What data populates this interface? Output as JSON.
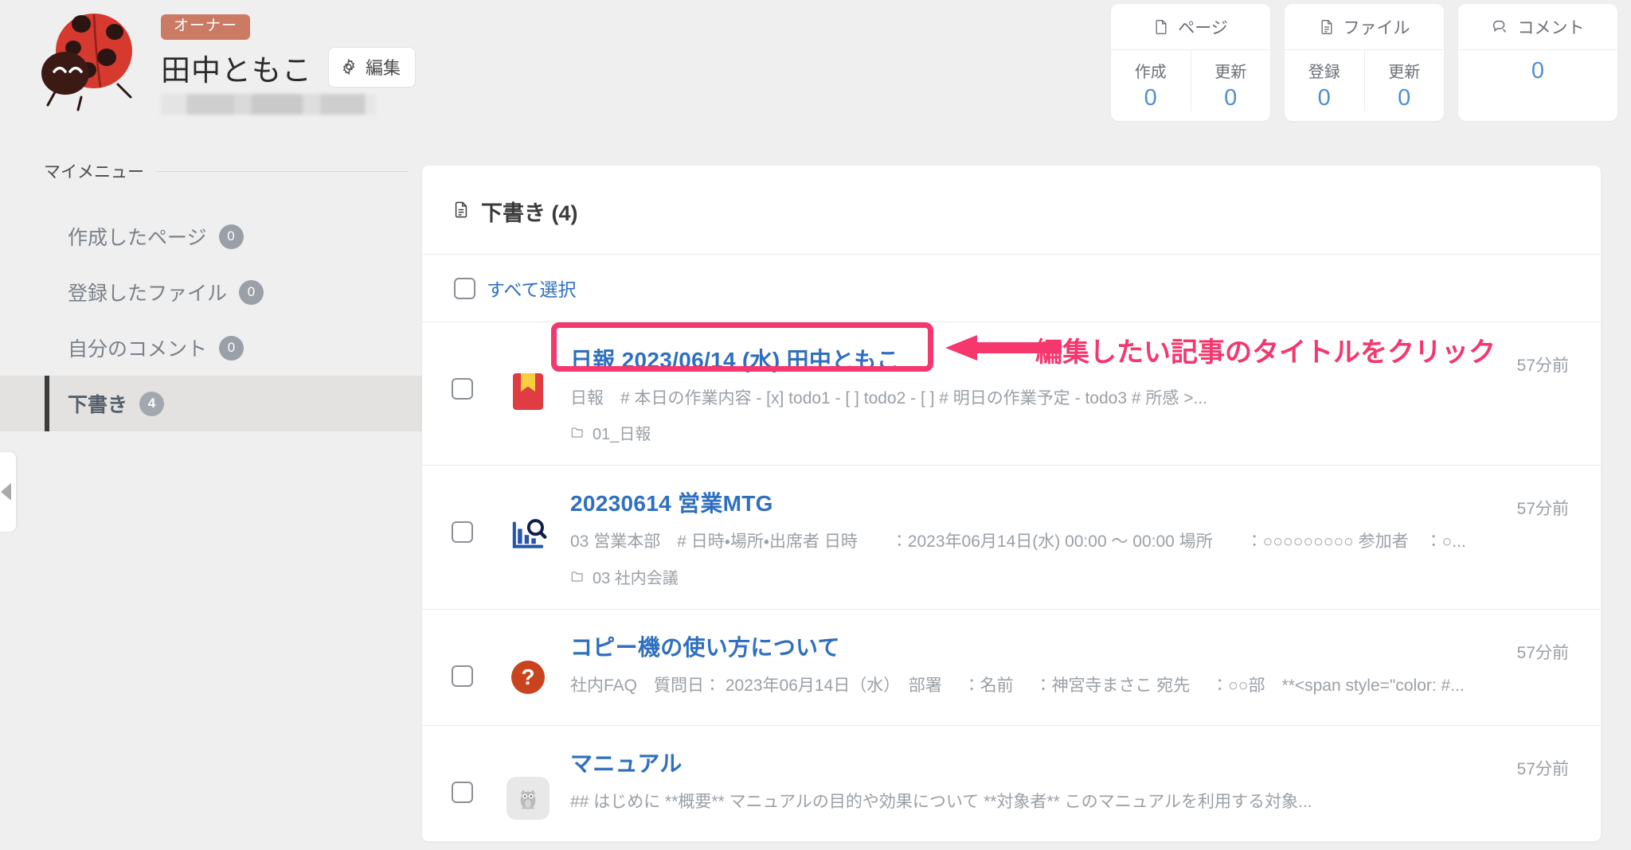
{
  "profile": {
    "badge": "オーナー",
    "name": "田中ともこ",
    "edit_label": "編集",
    "avatar_icon": "ladybug-avatar",
    "email_masked": ""
  },
  "stats": [
    {
      "icon": "page-icon",
      "title": "ページ",
      "columns": [
        {
          "label": "作成",
          "value": "0"
        },
        {
          "label": "更新",
          "value": "0"
        }
      ]
    },
    {
      "icon": "file-icon",
      "title": "ファイル",
      "columns": [
        {
          "label": "登録",
          "value": "0"
        },
        {
          "label": "更新",
          "value": "0"
        }
      ]
    },
    {
      "icon": "comment-icon",
      "title": "コメント",
      "columns": [
        {
          "label": "",
          "value": "0"
        }
      ]
    }
  ],
  "sidebar": {
    "section_title": "マイメニュー",
    "collapse_icon": "chevron-left-icon",
    "items": [
      {
        "label": "作成したページ",
        "count": "0",
        "active": false
      },
      {
        "label": "登録したファイル",
        "count": "0",
        "active": false
      },
      {
        "label": "自分のコメント",
        "count": "0",
        "active": false
      },
      {
        "label": "下書き",
        "count": "4",
        "active": true
      }
    ]
  },
  "panel": {
    "icon": "draft-document-icon",
    "title": "下書き (4)",
    "select_all_label": "すべて選択",
    "rows": [
      {
        "icon": "red-book-icon",
        "title": "日報 2023/06/14 (水) 田中ともこ",
        "desc": "日報　# 本日の作業内容 - [x] todo1 - [ ] todo2 - [ ] # 明日の作業予定 - todo3 # 所感 >...",
        "folder": "01_日報",
        "time": "57分前",
        "highlighted": true
      },
      {
        "icon": "chart-search-icon",
        "title": "20230614 営業MTG",
        "desc": "03 営業本部　# 日時・場所・出席者 日時　　：2023年06月14日(水) 00:00 〜 00:00 場所　　：○○○○○○○○○ 参加者　：○...",
        "folder": "03 社内会議",
        "time": "57分前",
        "highlighted": false
      },
      {
        "icon": "question-mark-icon",
        "title": "コピー機の使い方について",
        "desc": "社内FAQ　質問日： 2023年06月14日（水）　部署　 ：名前　 ：神宮寺まさこ 宛先　 ：○○部　**<span style=\"color: #...",
        "folder": "",
        "time": "57分前",
        "highlighted": false
      },
      {
        "icon": "owl-thumbnail-icon",
        "title": "マニュアル",
        "desc": "## はじめに **概要** マニュアルの目的や効果について **対象者** このマニュアルを利用する対象...",
        "folder": "",
        "time": "57分前",
        "highlighted": false
      }
    ]
  },
  "annotation": {
    "text": "編集したい記事のタイトルをクリック",
    "color": "#f5376e",
    "arrow_icon": "left-arrow-annotation"
  }
}
